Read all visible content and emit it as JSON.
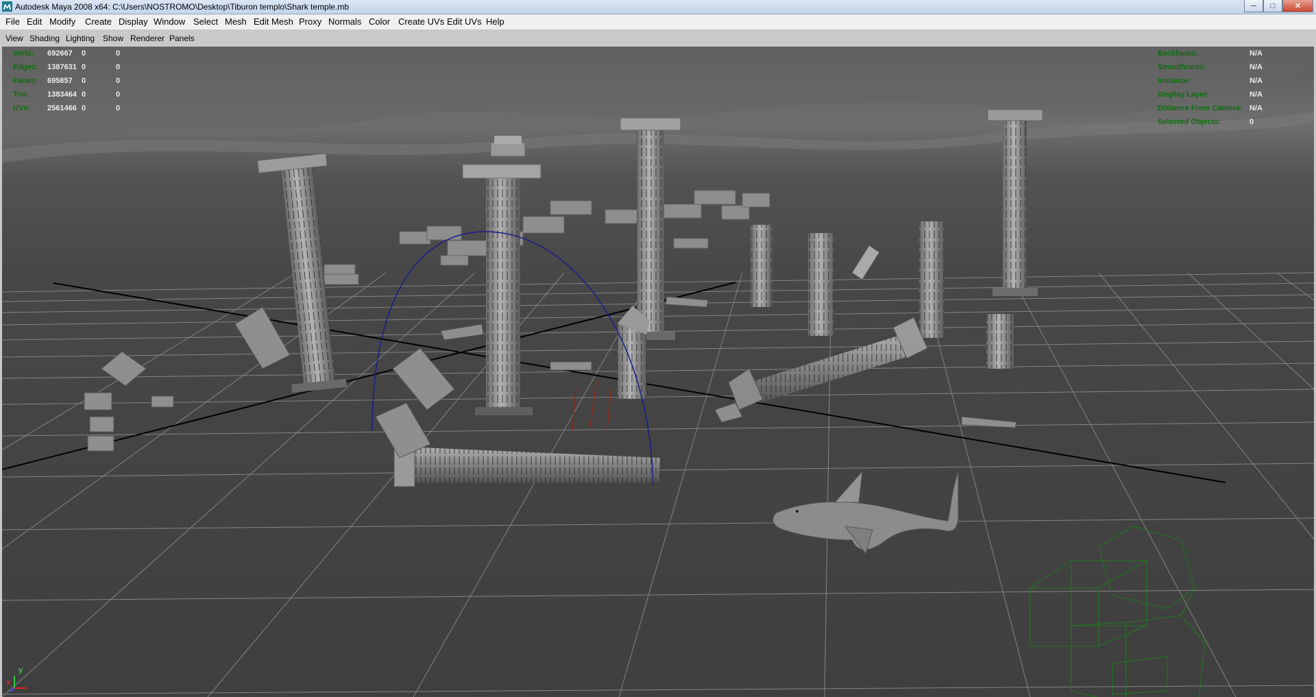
{
  "window": {
    "title": "Autodesk Maya 2008 x64: C:\\Users\\NOSTROMO\\Desktop\\Tiburon templo\\Shark temple.mb",
    "controls": [
      "minimize-icon",
      "maximize-icon",
      "close-icon"
    ]
  },
  "menubar": {
    "items": [
      "File",
      "Edit",
      "Modify",
      "Create",
      "Display",
      "Window",
      "Select",
      "Mesh",
      "Edit Mesh",
      "Proxy",
      "Normals",
      "Color",
      "Create UVs",
      "Edit UVs",
      "Help"
    ]
  },
  "panel_menu": {
    "items": [
      "View",
      "Shading",
      "Lighting",
      "Show",
      "Renderer",
      "Panels"
    ]
  },
  "hud_left": [
    {
      "label": "Verts:",
      "total": "692667",
      "selected": "0",
      "components": "0"
    },
    {
      "label": "Edges:",
      "total": "1387631",
      "selected": "0",
      "components": "0"
    },
    {
      "label": "Faces:",
      "total": "695857",
      "selected": "0",
      "components": "0"
    },
    {
      "label": "Tris:",
      "total": "1383464",
      "selected": "0",
      "components": "0"
    },
    {
      "label": "UVs:",
      "total": "2561466",
      "selected": "0",
      "components": "0"
    }
  ],
  "hud_right": [
    {
      "label": "Backfaces:",
      "value": "N/A"
    },
    {
      "label": "Smoothness:",
      "value": "N/A"
    },
    {
      "label": "Instance:",
      "value": "N/A"
    },
    {
      "label": "Display Layer:",
      "value": "N/A"
    },
    {
      "label": "Distance From Camera:",
      "value": "N/A"
    },
    {
      "label": "Selected Objects:",
      "value": "0"
    }
  ],
  "axis_gizmo": {
    "x": "x",
    "y": "y"
  },
  "colors": {
    "hud_label": "#0d6c0d",
    "viewport_bg": "#444444",
    "grid": "#8a8a8a",
    "axis_line": "#000000",
    "camera_wire": "#1f7a1f",
    "selection_arc": "#1c1c8c"
  }
}
